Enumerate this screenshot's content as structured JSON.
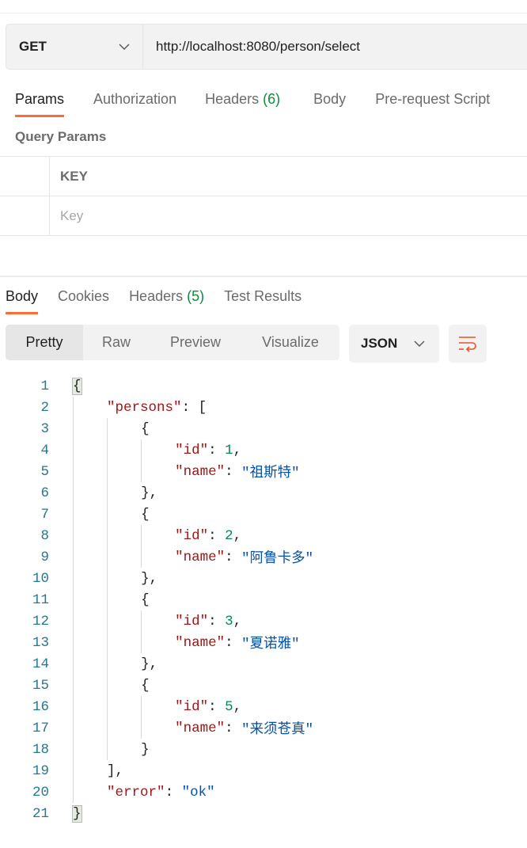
{
  "request": {
    "method": "GET",
    "url": "http://localhost:8080/person/select"
  },
  "request_tabs": [
    {
      "label": "Params",
      "active": true
    },
    {
      "label": "Authorization"
    },
    {
      "label": "Headers",
      "count": "(6)"
    },
    {
      "label": "Body"
    },
    {
      "label": "Pre-request Script"
    }
  ],
  "query_params": {
    "title": "Query Params",
    "header_key": "KEY",
    "key_placeholder": "Key"
  },
  "response_tabs": [
    {
      "label": "Body",
      "active": true
    },
    {
      "label": "Cookies"
    },
    {
      "label": "Headers",
      "count": "(5)"
    },
    {
      "label": "Test Results"
    }
  ],
  "view_modes": [
    "Pretty",
    "Raw",
    "Preview",
    "Visualize"
  ],
  "active_view": "Pretty",
  "format": "JSON",
  "colors": {
    "accent": "#ff6c37",
    "count": "#0f8a3e",
    "key": "#a31515",
    "number": "#098658",
    "string": "#0451a5",
    "line_number": "#237893"
  },
  "code_lines": [
    {
      "indent": 0,
      "tokens": [
        [
          "p",
          "{"
        ]
      ],
      "hl": true
    },
    {
      "indent": 1,
      "tokens": [
        [
          "k",
          "\"persons\""
        ],
        [
          "p",
          ": ["
        ]
      ]
    },
    {
      "indent": 2,
      "tokens": [
        [
          "p",
          "{"
        ]
      ]
    },
    {
      "indent": 3,
      "tokens": [
        [
          "k",
          "\"id\""
        ],
        [
          "p",
          ": "
        ],
        [
          "n",
          "1"
        ],
        [
          "p",
          ","
        ]
      ]
    },
    {
      "indent": 3,
      "tokens": [
        [
          "k",
          "\"name\""
        ],
        [
          "p",
          ": "
        ],
        [
          "s",
          "\"祖斯特\""
        ]
      ]
    },
    {
      "indent": 2,
      "tokens": [
        [
          "p",
          "},"
        ]
      ]
    },
    {
      "indent": 2,
      "tokens": [
        [
          "p",
          "{"
        ]
      ]
    },
    {
      "indent": 3,
      "tokens": [
        [
          "k",
          "\"id\""
        ],
        [
          "p",
          ": "
        ],
        [
          "n",
          "2"
        ],
        [
          "p",
          ","
        ]
      ]
    },
    {
      "indent": 3,
      "tokens": [
        [
          "k",
          "\"name\""
        ],
        [
          "p",
          ": "
        ],
        [
          "s",
          "\"阿鲁卡多\""
        ]
      ]
    },
    {
      "indent": 2,
      "tokens": [
        [
          "p",
          "},"
        ]
      ]
    },
    {
      "indent": 2,
      "tokens": [
        [
          "p",
          "{"
        ]
      ]
    },
    {
      "indent": 3,
      "tokens": [
        [
          "k",
          "\"id\""
        ],
        [
          "p",
          ": "
        ],
        [
          "n",
          "3"
        ],
        [
          "p",
          ","
        ]
      ]
    },
    {
      "indent": 3,
      "tokens": [
        [
          "k",
          "\"name\""
        ],
        [
          "p",
          ": "
        ],
        [
          "s",
          "\"夏诺雅\""
        ]
      ]
    },
    {
      "indent": 2,
      "tokens": [
        [
          "p",
          "},"
        ]
      ]
    },
    {
      "indent": 2,
      "tokens": [
        [
          "p",
          "{"
        ]
      ]
    },
    {
      "indent": 3,
      "tokens": [
        [
          "k",
          "\"id\""
        ],
        [
          "p",
          ": "
        ],
        [
          "n",
          "5"
        ],
        [
          "p",
          ","
        ]
      ]
    },
    {
      "indent": 3,
      "tokens": [
        [
          "k",
          "\"name\""
        ],
        [
          "p",
          ": "
        ],
        [
          "s",
          "\"来须苍真\""
        ]
      ]
    },
    {
      "indent": 2,
      "tokens": [
        [
          "p",
          "}"
        ]
      ]
    },
    {
      "indent": 1,
      "tokens": [
        [
          "p",
          "],"
        ]
      ]
    },
    {
      "indent": 1,
      "tokens": [
        [
          "k",
          "\"error\""
        ],
        [
          "p",
          ": "
        ],
        [
          "s",
          "\"ok\""
        ]
      ]
    },
    {
      "indent": 0,
      "tokens": [
        [
          "p",
          "}"
        ]
      ],
      "hl": true
    }
  ]
}
